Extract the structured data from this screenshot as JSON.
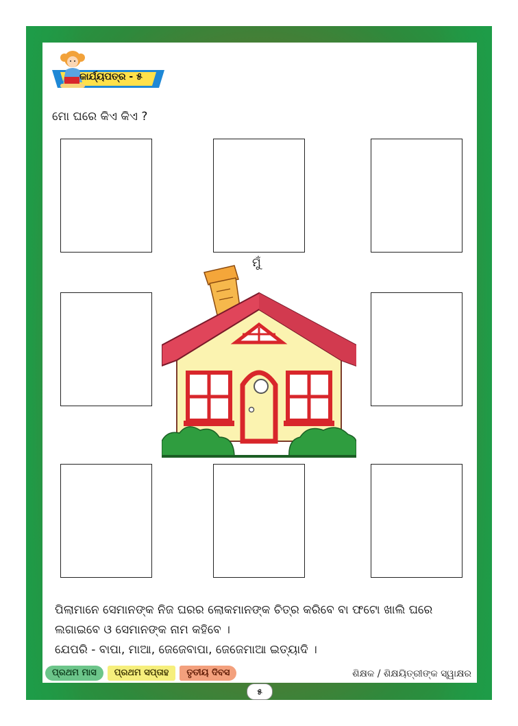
{
  "header": {
    "worksheet_label": "କାର୍ଯ୍ୟପତ୍ର - ୫"
  },
  "question": "ମୋ ଘରେ କିଏ କିଏ ?",
  "house": {
    "me_label": "ମୁଁ"
  },
  "instructions": {
    "line1": "ପିଲାମାନେ ସେମାନଙ୍କ ନିଜ ଘରର ଲୋକମାନଙ୍କ ଚିତ୍ର କରିବେ ବା ଫଟୋ ଖାଲି ଘରେ",
    "line2": "ଲଗାଇବେ ଓ ସେମାନଙ୍କ ନାମ କହିବେ ।",
    "line3": "ଯେପରି - ବାପା, ମାଆ, ଜେଜେବାପା, ଜେଜେମାଆ ଇତ୍ୟାଦି ।"
  },
  "footer": {
    "month": "ପ୍ରଥମ ମାସ",
    "week": "ପ୍ରଥମ ସପ୍ତାହ",
    "day": "ତୃତୀୟ ଦିବସ",
    "signature": "ଶିକ୍ଷକ / ଶିକ୍ଷୟିତ୍ରୀଙ୍କ ସ୍ୱାକ୍ଷର",
    "page_number": "୫"
  },
  "colors": {
    "frame_green": "#1e9c48",
    "frame_brown": "#8a5a2a",
    "banner_blue": "#1e88d6",
    "banner_yellow": "#ffe14a",
    "roof_red": "#e0455a",
    "wall_cream": "#fbf3b0",
    "window_red": "#d8262b",
    "bush_green": "#2f9d3f"
  }
}
